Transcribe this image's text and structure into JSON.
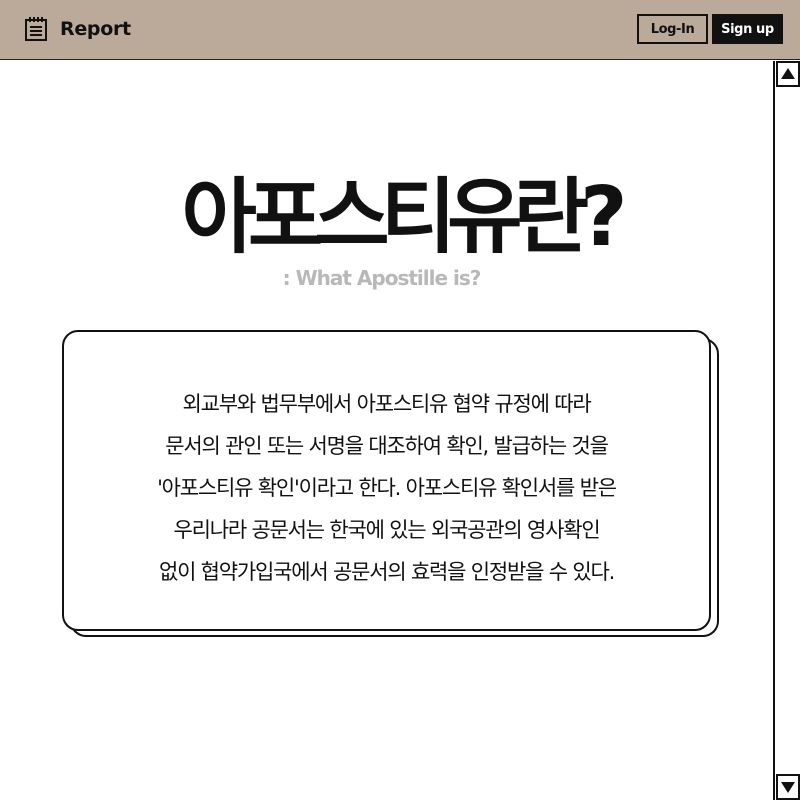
{
  "header": {
    "logo_label": "Report",
    "logo_icon": "notepad-icon",
    "login_label": "Log-In",
    "signup_label": "Sign up",
    "background_color": "#bba999"
  },
  "main": {
    "title": "아포스티유란?",
    "subtitle": ": What Apostille is?",
    "description_lines": [
      "외교부와 법무부에서 아포스티유 협약 규정에 따라",
      "문서의 관인 또는 서명을 대조하여 확인, 발급하는 것을",
      "'아포스티유 확인'이라고 한다. 아포스티유 확인서를 받은",
      "우리나라 공문서는 한국에 있는 외국공관의 영사확인",
      "없이 협약가입국에서 공문서의 효력을 인정받을 수 있다."
    ]
  },
  "scrollbar": {
    "up_icon": "arrow-up-icon",
    "down_icon": "arrow-down-icon"
  }
}
